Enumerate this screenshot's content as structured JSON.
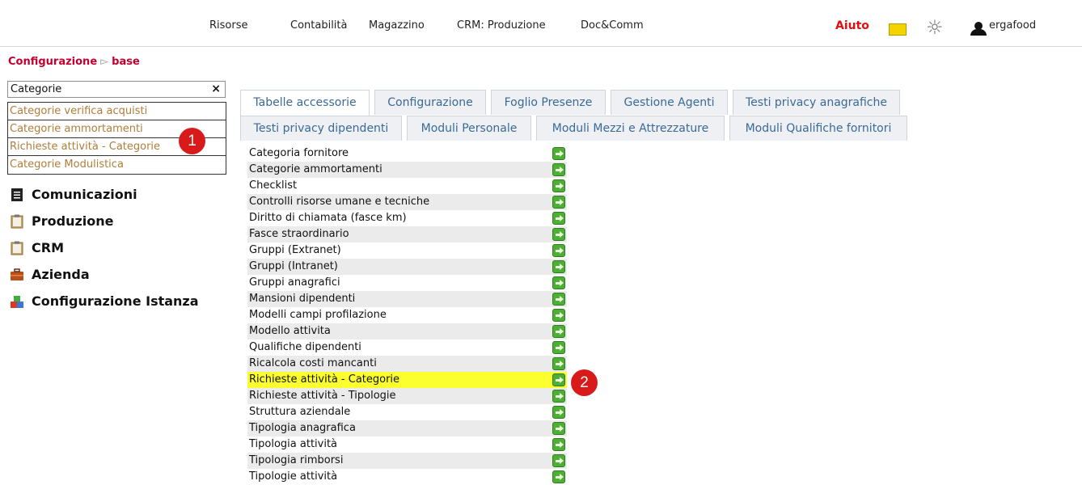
{
  "topnav": {
    "items": [
      "Risorse",
      "Contabilità",
      "Magazzino",
      "CRM: Produzione",
      "Doc&Comm"
    ],
    "help": "Aiuto",
    "username": "ergafood"
  },
  "breadcrumb": {
    "root": "Configurazione",
    "separator": "▻",
    "current": "base"
  },
  "search": {
    "value": "Categorie",
    "clear": "×",
    "suggestions": [
      "Categorie verifica acquisti",
      "Categorie ammortamenti",
      "Richieste attività - Categorie",
      "Categorie Modulistica"
    ]
  },
  "badges": {
    "one": "1",
    "two": "2"
  },
  "sidebar": {
    "items": [
      "Comunicazioni",
      "Produzione",
      "CRM",
      "Azienda",
      "Configurazione Istanza"
    ]
  },
  "tabs": {
    "row1": [
      "Tabelle accessorie",
      "Configurazione",
      "Foglio Presenze",
      "Gestione Agenti",
      "Testi privacy anagrafiche"
    ],
    "row2": [
      "Testi privacy dipendenti",
      "Moduli Personale",
      "Moduli Mezzi e Attrezzature",
      "Moduli Qualifiche fornitori"
    ]
  },
  "list": {
    "items": [
      "Categoria fornitore",
      "Categorie ammortamenti",
      "Checklist",
      "Controlli risorse umane e tecniche",
      "Diritto di chiamata (fasce km)",
      "Fasce straordinario",
      "Gruppi (Extranet)",
      "Gruppi (Intranet)",
      "Gruppi anagrafici",
      "Mansioni dipendenti",
      "Modelli campi profilazione",
      "Modello attivita",
      "Qualifiche dipendenti",
      "Ricalcola costi mancanti",
      "Richieste attività - Categorie",
      "Richieste attività - Tipologie",
      "Struttura aziendale",
      "Tipologia anagrafica",
      "Tipologia attività",
      "Tipologia rimborsi",
      "Tipologie attività"
    ],
    "highlighted_index": 14
  },
  "colors": {
    "accent": "#c3002f",
    "help": "#e01010",
    "highlight": "#fcff2e",
    "tab_text": "#3a6a98",
    "go_button": "#4fae35"
  }
}
